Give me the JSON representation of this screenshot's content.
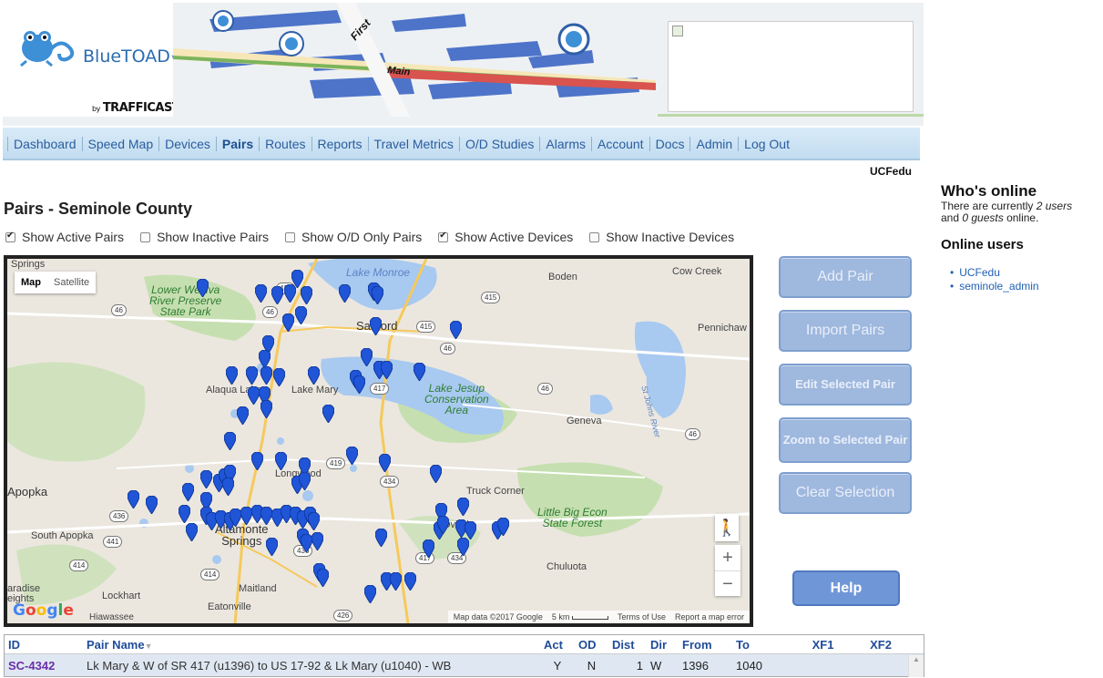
{
  "header": {
    "logo_text": "BlueTOAD",
    "logo_tm": "™",
    "logo_by": "by",
    "logo_company": "TRAFFICAST",
    "art_labels": [
      "First",
      "Main"
    ]
  },
  "nav": {
    "items": [
      {
        "label": "Dashboard",
        "active": false
      },
      {
        "label": "Speed Map",
        "active": false
      },
      {
        "label": "Devices",
        "active": false
      },
      {
        "label": "Pairs",
        "active": true
      },
      {
        "label": "Routes",
        "active": false
      },
      {
        "label": "Reports",
        "active": false
      },
      {
        "label": "Travel Metrics",
        "active": false
      },
      {
        "label": "O/D Studies",
        "active": false
      },
      {
        "label": "Alarms",
        "active": false
      },
      {
        "label": "Account",
        "active": false
      },
      {
        "label": "Docs",
        "active": false
      },
      {
        "label": "Admin",
        "active": false
      },
      {
        "label": "Log Out",
        "active": false
      }
    ],
    "user": "UCFedu"
  },
  "page": {
    "title": "Pairs - Seminole County"
  },
  "filters": [
    {
      "label": "Show Active Pairs",
      "checked": true
    },
    {
      "label": "Show Inactive Pairs",
      "checked": false
    },
    {
      "label": "Show O/D Only Pairs",
      "checked": false
    },
    {
      "label": "Show Active Devices",
      "checked": true
    },
    {
      "label": "Show Inactive Devices",
      "checked": false
    }
  ],
  "map": {
    "type_map": "Map",
    "type_satellite": "Satellite",
    "attribution": "Map data ©2017 Google",
    "scale": "5 km",
    "terms": "Terms of Use",
    "report": "Report a map error",
    "google": [
      "G",
      "o",
      "o",
      "g",
      "l",
      "e"
    ],
    "places": {
      "springs": "Springs",
      "lake_monroe": "Lake Monroe",
      "boden": "Boden",
      "cow_creek": "Cow Creek",
      "lower_wekiva": "Lower Wekiva",
      "river_preserve": "River Preserve",
      "state_park": "State Park",
      "sanford": "Sanford",
      "pennichaw": "Pennichaw",
      "alaqua_lakes": "Alaqua Lakes",
      "lake_mary": "Lake Mary",
      "lake_jesup_1": "Lake Jesup",
      "lake_jesup_2": "Conservation",
      "lake_jesup_3": "Area",
      "geneva": "Geneva",
      "st_johns": "St Johns River",
      "longwood": "Longwood",
      "apopka": "Apopka",
      "truck_corner": "Truck Corner",
      "little_big_1": "Little Big Econ",
      "little_big_2": "State Forest",
      "south_apopka": "South Apopka",
      "altamonte": "Altamonte",
      "springs2": "Springs",
      "oviedo": "Oviedo",
      "chuluota": "Chuluota",
      "paradise": "aradise",
      "heights": "eights",
      "lockhart": "Lockhart",
      "maitland": "Maitland",
      "eatonville": "Eatonville",
      "hiawassee": "Hiawassee"
    },
    "shields": [
      "431",
      "415",
      "46",
      "415",
      "46",
      "46",
      "417",
      "46",
      "46",
      "419",
      "434",
      "436",
      "441",
      "414",
      "414",
      "436",
      "417",
      "434",
      "426"
    ]
  },
  "buttons": {
    "add_pair": "Add Pair",
    "import_pairs": "Import Pairs",
    "edit_selected": "Edit Selected Pair",
    "zoom_selected": "Zoom to Selected Pair",
    "clear_selection": "Clear Selection",
    "help": "Help"
  },
  "online": {
    "title": "Who's online",
    "text_1": "There are currently ",
    "users_count": "2 users",
    "text_2": "and ",
    "guests_count": "0 guests",
    "text_3": " online.",
    "users_title": "Online users",
    "users": [
      "UCFedu",
      "seminole_admin"
    ]
  },
  "table": {
    "headers": {
      "id": "ID",
      "name": "Pair Name",
      "act": "Act",
      "od": "OD",
      "dist": "Dist",
      "dir": "Dir",
      "from": "From",
      "to": "To",
      "xf1": "XF1",
      "xf2": "XF2"
    },
    "rows": [
      {
        "id": "SC-4342",
        "name": "Lk Mary & W of SR 417 (u1396) to US 17-92 & Lk Mary (u1040) - WB",
        "act": "Y",
        "od": "N",
        "dist": "1",
        "dir": "W",
        "from": "1396",
        "to": "1040",
        "xf1": "",
        "xf2": ""
      }
    ]
  },
  "colors": {
    "nav_text": "#2a5d9f",
    "button_disabled": "#9fb8de",
    "help_button": "#6f97d8",
    "pin": "#1f55d6",
    "row_id": "#6b2ea8"
  }
}
